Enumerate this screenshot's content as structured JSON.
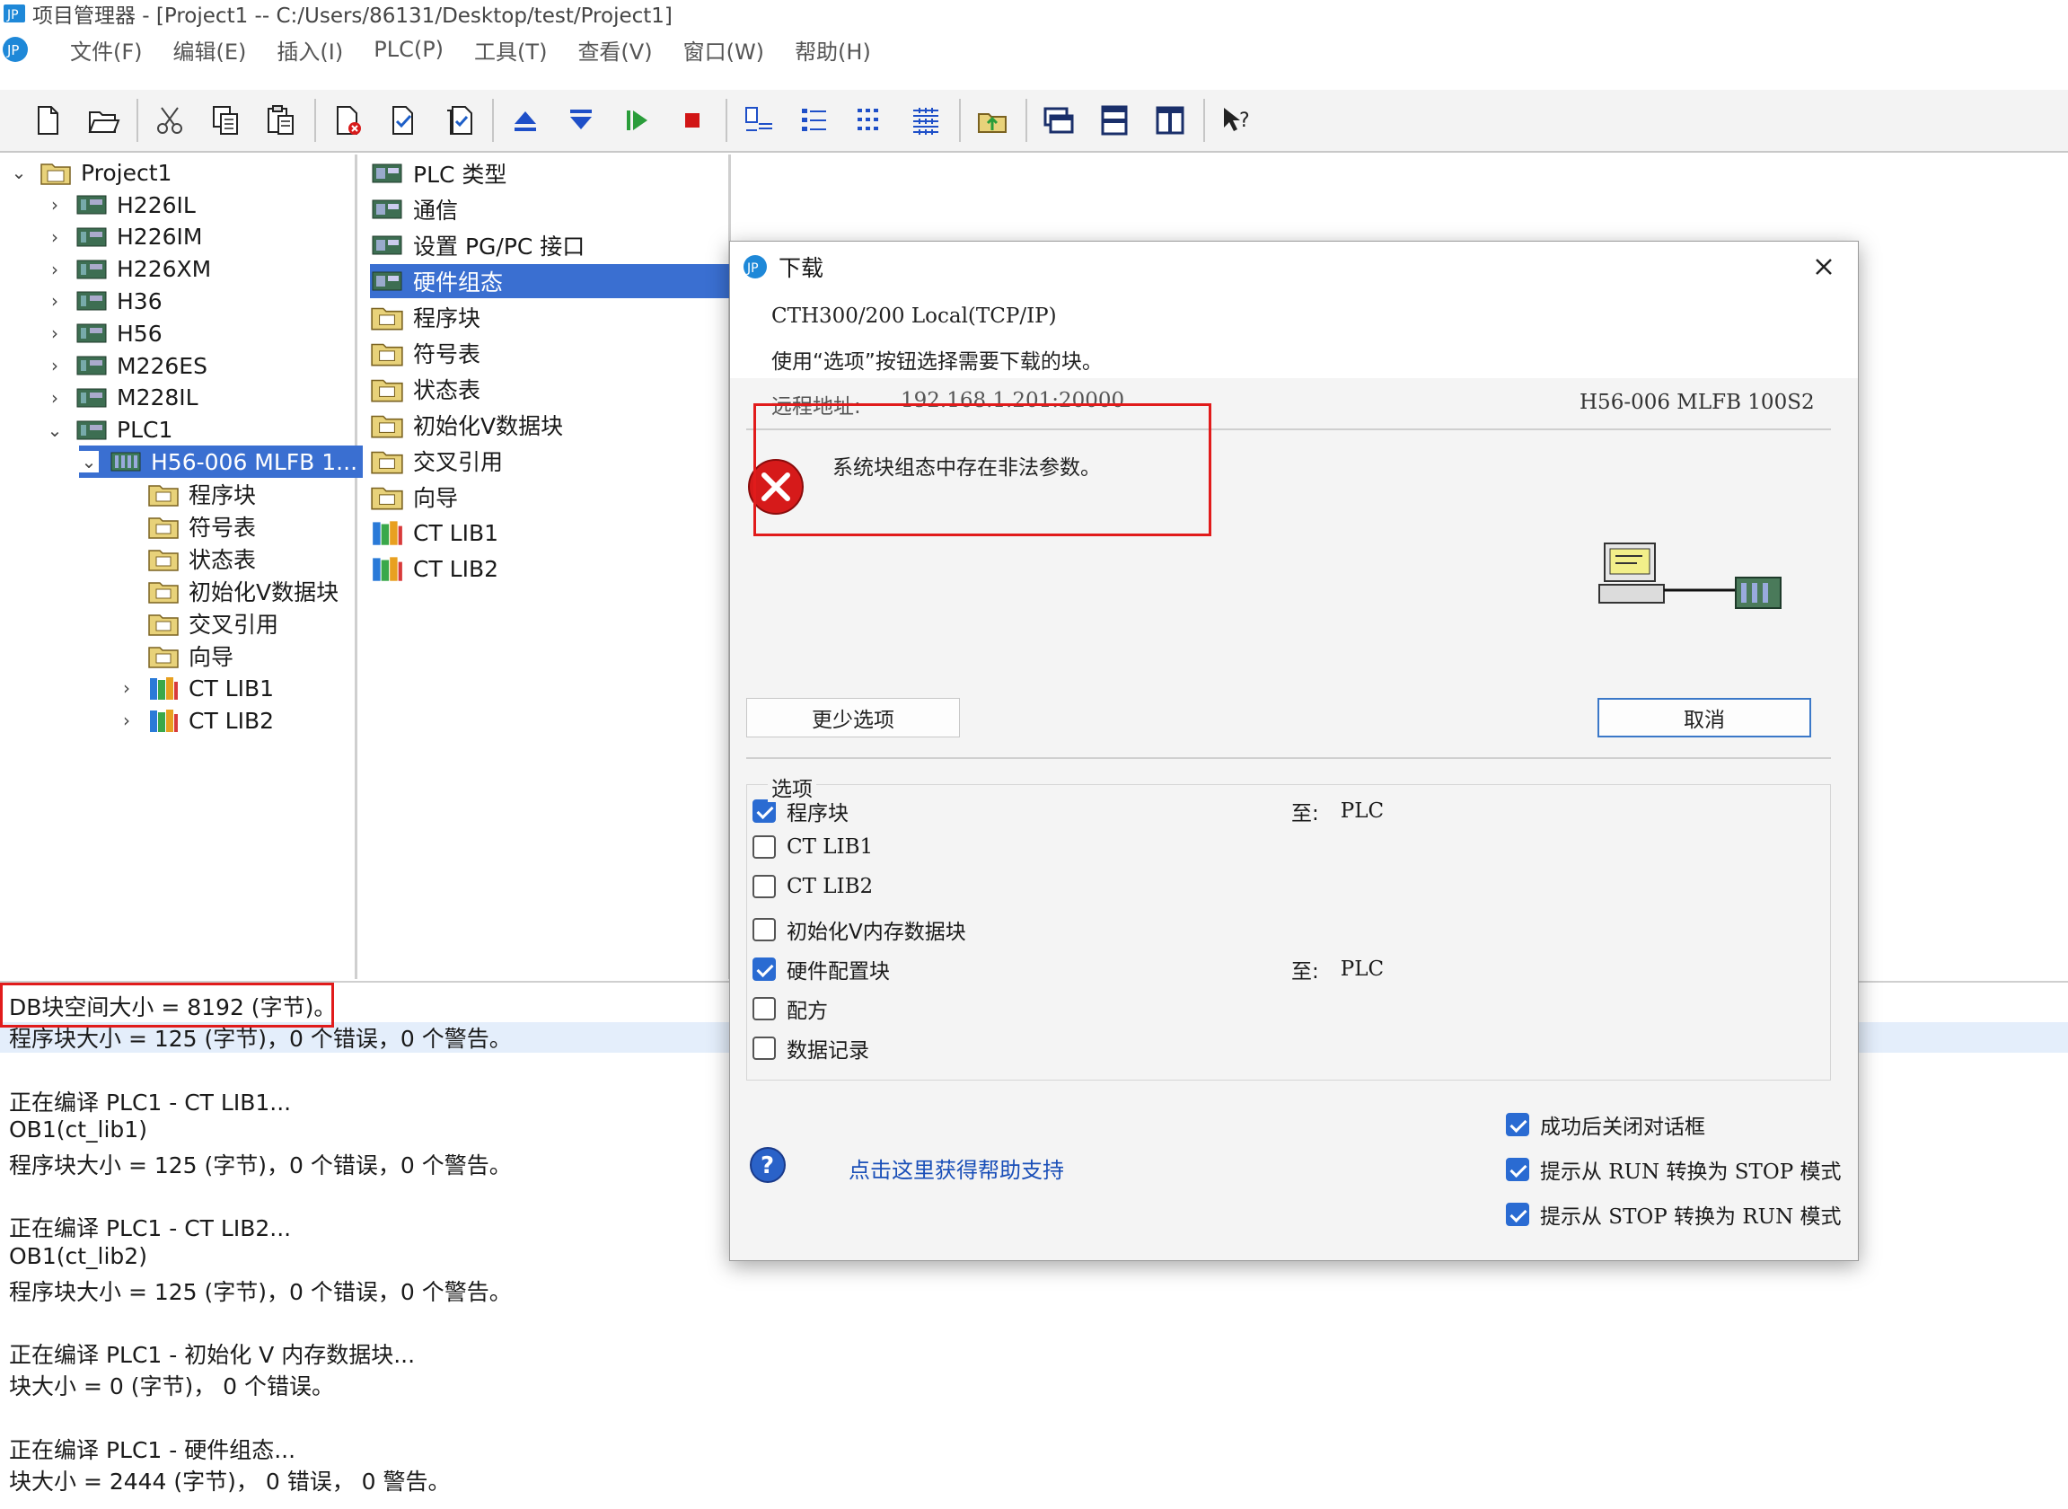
{
  "window": {
    "title": "项目管理器 - [Project1 -- C:/Users/86131/Desktop/test/Project1]"
  },
  "menu": [
    "文件(F)",
    "编辑(E)",
    "插入(I)",
    "PLC(P)",
    "工具(T)",
    "查看(V)",
    "窗口(W)",
    "帮助(H)"
  ],
  "toolbar_icons": [
    "new-file-icon",
    "open-folder-icon",
    "cut-icon",
    "copy-icon",
    "paste-icon",
    "compile-icon",
    "check-icon",
    "compile-all-icon",
    "upload-icon",
    "download-icon",
    "run-icon",
    "stop-icon",
    "layout1-icon",
    "list-icon",
    "details-icon",
    "grid-icon",
    "export-icon",
    "windows-icon",
    "split-h-icon",
    "split-v-icon",
    "help-cursor-icon"
  ],
  "tree": {
    "root": "Project1",
    "devices": [
      "H226IL",
      "H226IM",
      "H226XM",
      "H36",
      "H56",
      "M226ES",
      "M228IL",
      "PLC1"
    ],
    "selected": "H56-006 MLFB 1...",
    "children": [
      "程序块",
      "符号表",
      "状态表",
      "初始化V数据块",
      "交叉引用",
      "向导",
      "CT LIB1",
      "CT LIB2"
    ]
  },
  "list": {
    "items": [
      "PLC 类型",
      "通信",
      "设置 PG/PC 接口",
      "硬件组态",
      "程序块",
      "符号表",
      "状态表",
      "初始化V数据块",
      "交叉引用",
      "向导",
      "CT LIB1",
      "CT LIB2"
    ],
    "selected_index": 3
  },
  "output": {
    "lines": [
      "DB块空间大小 = 8192 (字节)。",
      "程序块大小 = 125 (字节)，0 个错误，0 个警告。",
      "",
      "正在编译 PLC1 - CT LIB1...",
      "OB1(ct_lib1)",
      "程序块大小 = 125 (字节)，0 个错误，0 个警告。",
      "",
      "正在编译 PLC1 - CT LIB2...",
      "OB1(ct_lib2)",
      "程序块大小 = 125 (字节)，0 个错误，0 个警告。",
      "",
      "正在编译 PLC1 - 初始化 V 内存数据块...",
      "块大小 = 0 (字节)， 0 个错误。",
      "",
      "正在编译 PLC1 - 硬件组态...",
      "块大小 = 2444 (字节)， 0 错误， 0 警告。"
    ]
  },
  "dialog": {
    "title": "下载",
    "connection": "CTH300/200 Local(TCP/IP)",
    "instruction": "使用“选项”按钮选择需要下载的块。",
    "remote_label": "远程地址:",
    "remote_value": "192.168.1.201:20000",
    "device": "H56-006 MLFB 100S2",
    "error": "系统块组态中存在非法参数。",
    "fewer_options": "更少选项",
    "cancel": "取消",
    "options_title": "选项",
    "to_label": "至:",
    "to_value": "PLC",
    "options": [
      {
        "label": "程序块",
        "checked": true,
        "to": true
      },
      {
        "label": "CT LIB1",
        "checked": false,
        "to": false
      },
      {
        "label": "CT LIB2",
        "checked": false,
        "to": false
      },
      {
        "label": "初始化V内存数据块",
        "checked": false,
        "to": false
      },
      {
        "label": "硬件配置块",
        "checked": true,
        "to": true
      },
      {
        "label": "配方",
        "checked": false,
        "to": false
      },
      {
        "label": "数据记录",
        "checked": false,
        "to": false
      }
    ],
    "help_link": "点击这里获得帮助支持",
    "bottom_checks": [
      {
        "label": "成功后关闭对话框",
        "checked": true
      },
      {
        "label": "提示从 RUN 转换为 STOP 模式",
        "checked": true
      },
      {
        "label": "提示从 STOP 转换为 RUN 模式",
        "checked": true
      }
    ]
  },
  "colors": {
    "selection": "#3a6fd1",
    "highlight_box": "#e11b1b",
    "link": "#1a4fb8",
    "checkbox": "#2a6bd2"
  }
}
